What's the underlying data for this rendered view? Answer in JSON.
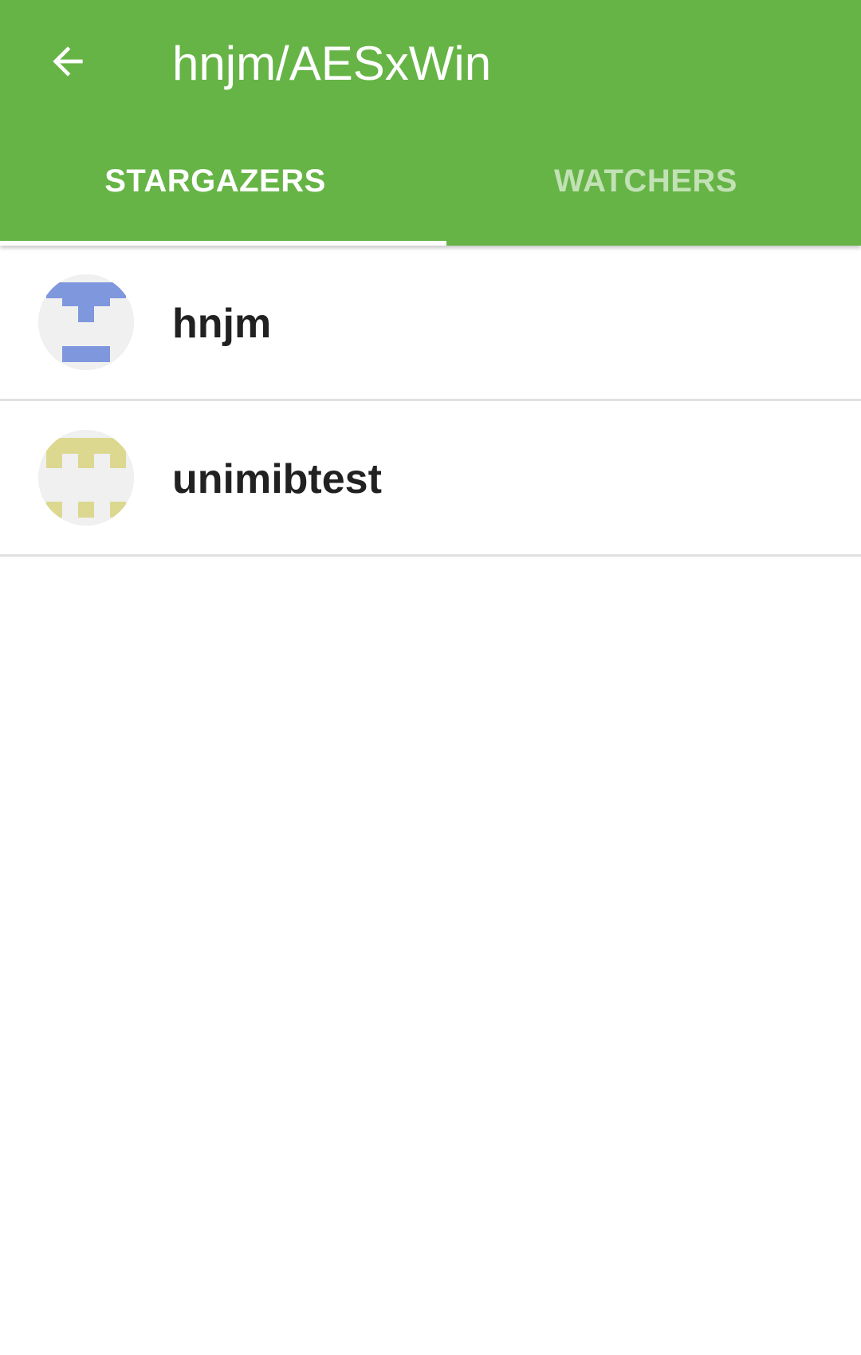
{
  "app_bar": {
    "title": "hnjm/AESxWin",
    "back_icon": "arrow-back-icon",
    "background_color": "#66b446"
  },
  "tabs": [
    {
      "label": "STARGAZERS",
      "active": true
    },
    {
      "label": "WATCHERS",
      "active": false
    }
  ],
  "users": [
    {
      "username": "hnjm",
      "avatar_icon": "identicon-blue",
      "avatar_color": "#7f97dd"
    },
    {
      "username": "unimibtest",
      "avatar_icon": "identicon-yellow",
      "avatar_color": "#dcd890"
    }
  ]
}
